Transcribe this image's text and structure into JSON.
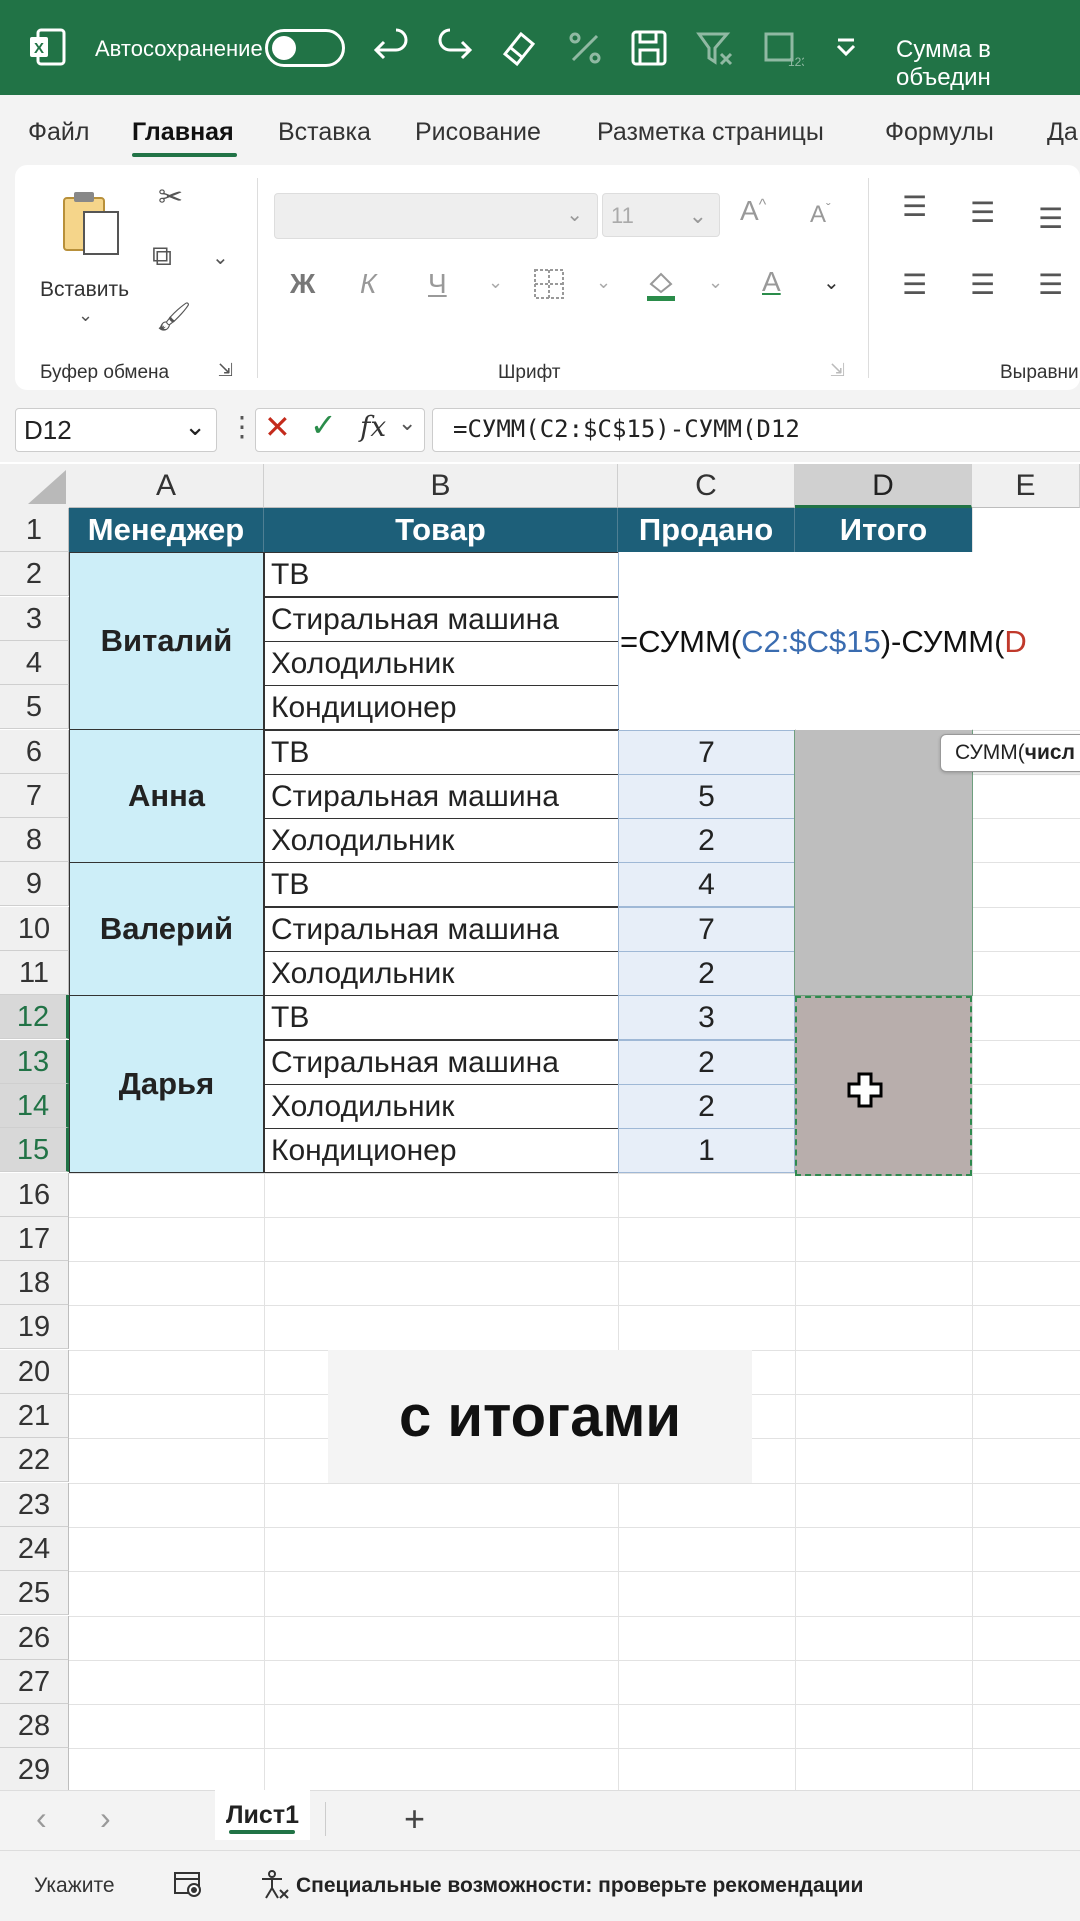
{
  "titlebar": {
    "autosave_label": "Автосохранение",
    "doc_title": "Сумма в объедин",
    "colors": {
      "bg": "#217346"
    },
    "icons": [
      "excel-logo-icon",
      "undo-icon",
      "redo-icon",
      "eraser-icon",
      "percent-icon",
      "save-icon",
      "filter-clear-icon",
      "number-format-icon",
      "chevron-down-icon"
    ]
  },
  "menu": {
    "tabs": [
      "Файл",
      "Главная",
      "Вставка",
      "Рисование",
      "Разметка страницы",
      "Формулы",
      "Да"
    ],
    "active": "Главная"
  },
  "ribbon": {
    "clipboard": {
      "paste_label": "Вставить",
      "group_label": "Буфер обмена"
    },
    "font": {
      "font_name": "",
      "font_size": "11",
      "bold": "Ж",
      "italic": "К",
      "underline": "Ч",
      "font_color": "A",
      "group_label": "Шрифт"
    },
    "align": {
      "group_label": "Выравни"
    }
  },
  "formula_bar": {
    "name_box": "D12",
    "fx": "fx",
    "formula": "=СУММ(C2:$C$15)-СУММ(D12"
  },
  "grid": {
    "columns": [
      "A",
      "B",
      "C",
      "D",
      "E"
    ],
    "selected_column": "D",
    "rows": [
      "1",
      "2",
      "3",
      "4",
      "5",
      "6",
      "7",
      "8",
      "9",
      "10",
      "11",
      "12",
      "13",
      "14",
      "15",
      "16",
      "17",
      "18",
      "19",
      "20",
      "21",
      "22",
      "23",
      "24",
      "25",
      "26",
      "27",
      "28",
      "29"
    ],
    "headers": {
      "manager": "Менеджер",
      "product": "Товар",
      "sold": "Продано",
      "total": "Итого"
    },
    "managers": [
      "Виталий",
      "Анна",
      "Валерий",
      "Дарья"
    ],
    "products": [
      "ТВ",
      "Стиральная машина",
      "Холодильник",
      "Кондиционер",
      "ТВ",
      "Стиральная машина",
      "Холодильник",
      "ТВ",
      "Стиральная машина",
      "Холодильник",
      "ТВ",
      "Стиральная машина",
      "Холодильник",
      "Кондиционер"
    ],
    "sold": [
      "",
      "",
      "",
      "",
      "7",
      "5",
      "2",
      "4",
      "7",
      "2",
      "3",
      "2",
      "2",
      "1"
    ],
    "inline_formula": {
      "prefix": "=СУММ(",
      "ref1": "C2:$C$15",
      "middle": ")-СУММ(",
      "ref2": "D"
    },
    "tooltip": {
      "fn": "СУММ(",
      "arg": "числ"
    }
  },
  "caption": "с итогами",
  "sheets": {
    "tabs": [
      "Лист1"
    ],
    "active": "Лист1",
    "add": "+"
  },
  "status": {
    "mode": "Укажите",
    "accessibility": "Специальные возможности: проверьте рекомендации"
  }
}
